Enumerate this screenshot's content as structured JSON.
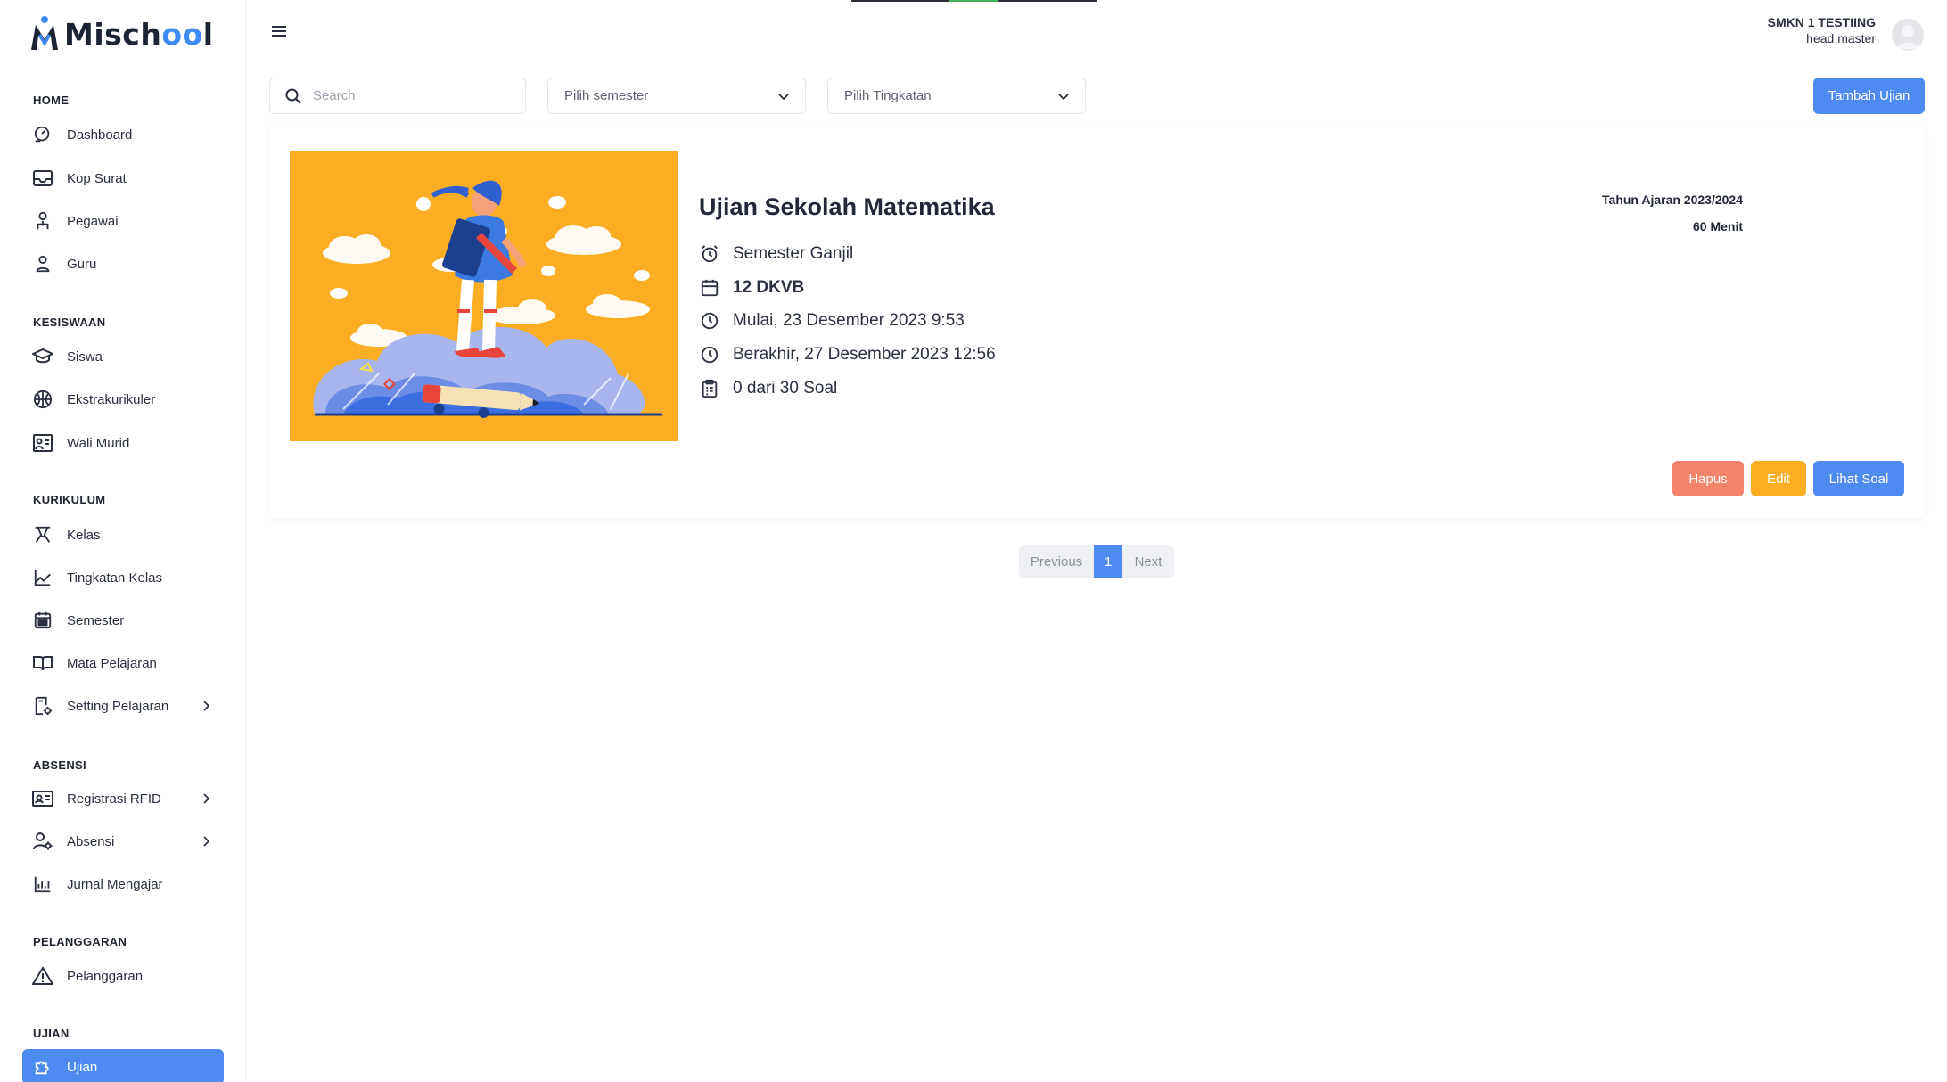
{
  "app": {
    "logo_text_prefix": "Misch",
    "logo_text_oo": "oo",
    "logo_text_suffix": "l"
  },
  "sidebar": {
    "sections": {
      "home": "HOME",
      "kesiswaan": "KESISWAAN",
      "kurikulum": "KURIKULUM",
      "absensi": "ABSENSI",
      "pelanggaran": "PELANGGARAN",
      "ujian": "UJIAN"
    },
    "items": {
      "dashboard": "Dashboard",
      "kop_surat": "Kop Surat",
      "pegawai": "Pegawai",
      "guru": "Guru",
      "siswa": "Siswa",
      "ekstrakurikuler": "Ekstrakurikuler",
      "wali_murid": "Wali Murid",
      "kelas": "Kelas",
      "tingkatan_kelas": "Tingkatan Kelas",
      "semester": "Semester",
      "mata_pelajaran": "Mata Pelajaran",
      "setting_pelajaran": "Setting Pelajaran",
      "registrasi_rfid": "Registrasi RFID",
      "absensi": "Absensi",
      "jurnal_mengajar": "Jurnal Mengajar",
      "pelanggaran": "Pelanggaran",
      "ujian": "Ujian"
    },
    "active_item": "ujian"
  },
  "header": {
    "user_name": "SMKN 1 TESTIING",
    "user_role": "head master"
  },
  "filters": {
    "search_placeholder": "Search",
    "semester_select": "Pilih semester",
    "tingkatan_select": "Pilih Tingkatan",
    "add_button": "Tambah Ujian"
  },
  "exam": {
    "title": "Ujian Sekolah Matematika",
    "semester": "Semester Ganjil",
    "class": "12 DKVB",
    "start": "Mulai, 23 Desember 2023 9:53",
    "end": "Berakhir, 27 Desember 2023 12:56",
    "questions": "0 dari 30 Soal",
    "academic_year": "Tahun Ajaran 2023/2024",
    "duration": "60 Menit",
    "delete_label": "Hapus",
    "edit_label": "Edit",
    "view_label": "Lihat Soal"
  },
  "pagination": {
    "prev": "Previous",
    "current": "1",
    "next": "Next"
  },
  "colors": {
    "primary": "#4d8bf0",
    "warning": "#fbae24",
    "danger": "#f4836b",
    "illustration_bg": "#fbae24"
  }
}
